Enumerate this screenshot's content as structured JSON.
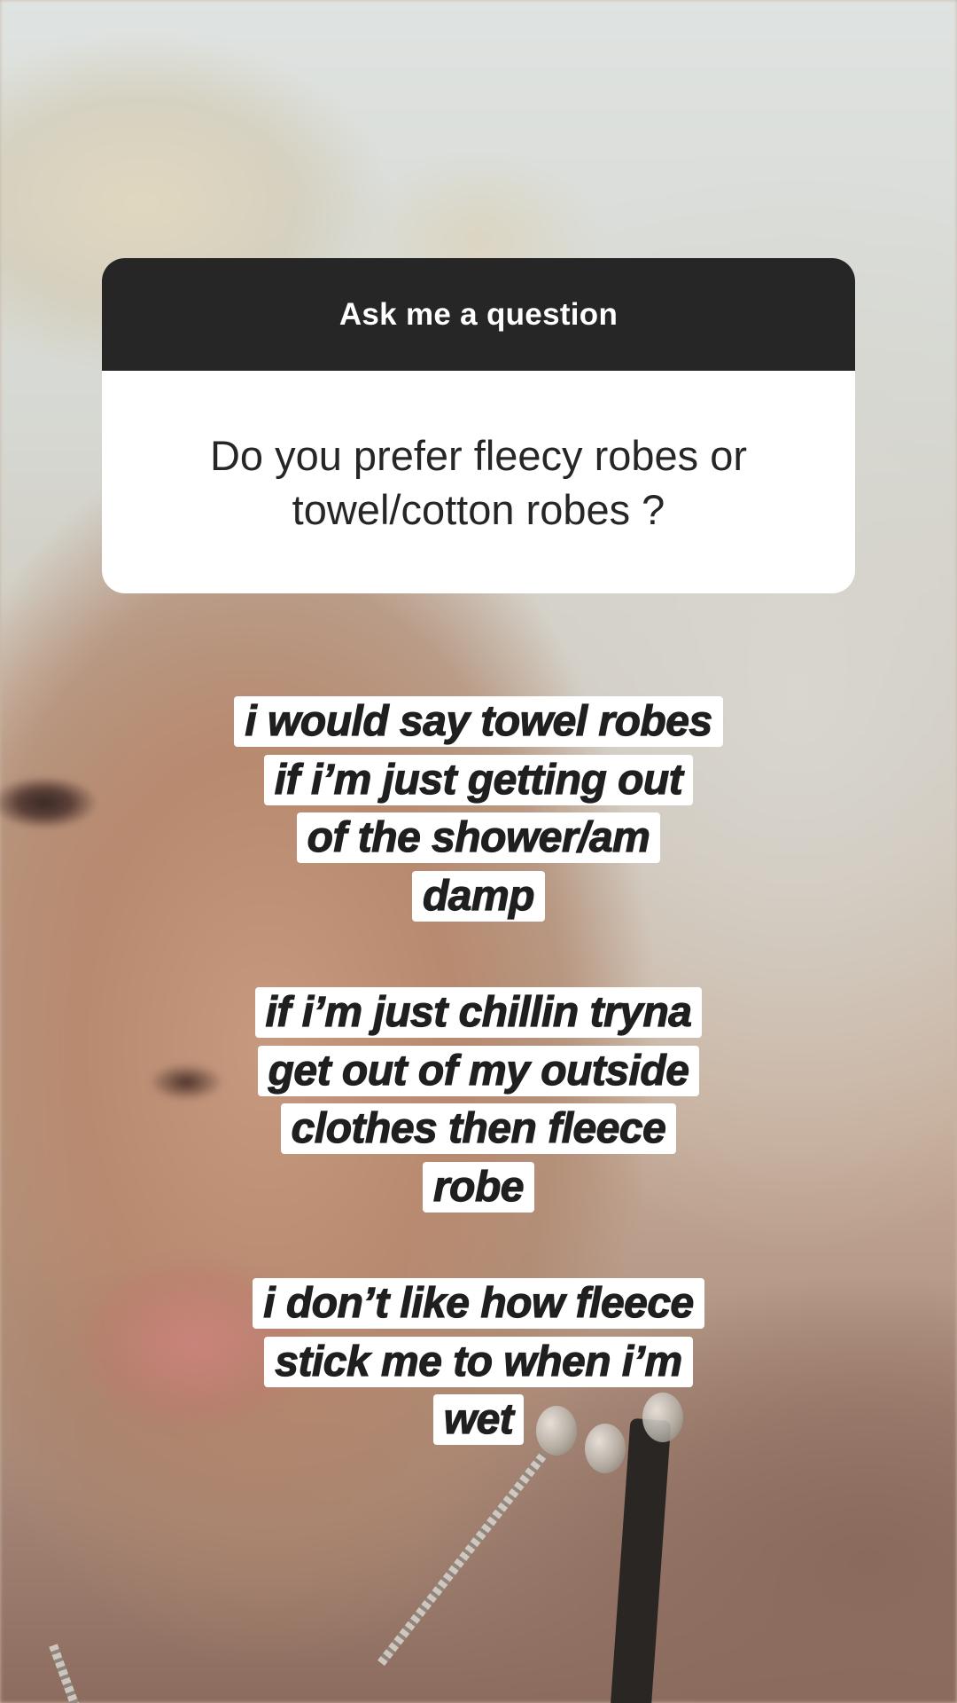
{
  "sticker": {
    "title": "Ask me a question",
    "question_line1": "Do you prefer fleecy robes or",
    "question_line2": "towel/cotton robes ?"
  },
  "answer": {
    "paragraphs": [
      [
        "i would say towel robes",
        "if i’m just getting out",
        "of the shower/am",
        "damp"
      ],
      [
        "if i’m just chillin tryna",
        "get out of my outside",
        "clothes then fleece",
        "robe"
      ],
      [
        "i don’t like how fleece",
        "stick me to when i’m",
        "wet"
      ]
    ]
  },
  "colors": {
    "sticker_header": "#262626",
    "sticker_body": "#ffffff",
    "highlight": "#ffffff",
    "text_dark": "#1f1f1f"
  }
}
